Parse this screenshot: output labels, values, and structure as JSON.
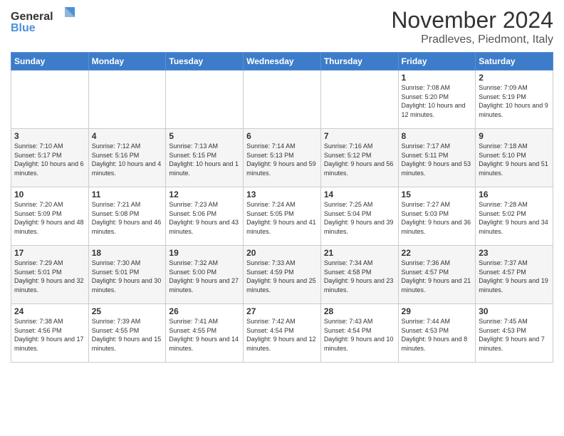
{
  "logo": {
    "line1": "General",
    "line2": "Blue"
  },
  "header": {
    "title": "November 2024",
    "location": "Pradleves, Piedmont, Italy"
  },
  "weekdays": [
    "Sunday",
    "Monday",
    "Tuesday",
    "Wednesday",
    "Thursday",
    "Friday",
    "Saturday"
  ],
  "weeks": [
    [
      {
        "day": "",
        "info": ""
      },
      {
        "day": "",
        "info": ""
      },
      {
        "day": "",
        "info": ""
      },
      {
        "day": "",
        "info": ""
      },
      {
        "day": "",
        "info": ""
      },
      {
        "day": "1",
        "info": "Sunrise: 7:08 AM\nSunset: 5:20 PM\nDaylight: 10 hours and 12 minutes."
      },
      {
        "day": "2",
        "info": "Sunrise: 7:09 AM\nSunset: 5:19 PM\nDaylight: 10 hours and 9 minutes."
      }
    ],
    [
      {
        "day": "3",
        "info": "Sunrise: 7:10 AM\nSunset: 5:17 PM\nDaylight: 10 hours and 6 minutes."
      },
      {
        "day": "4",
        "info": "Sunrise: 7:12 AM\nSunset: 5:16 PM\nDaylight: 10 hours and 4 minutes."
      },
      {
        "day": "5",
        "info": "Sunrise: 7:13 AM\nSunset: 5:15 PM\nDaylight: 10 hours and 1 minute."
      },
      {
        "day": "6",
        "info": "Sunrise: 7:14 AM\nSunset: 5:13 PM\nDaylight: 9 hours and 59 minutes."
      },
      {
        "day": "7",
        "info": "Sunrise: 7:16 AM\nSunset: 5:12 PM\nDaylight: 9 hours and 56 minutes."
      },
      {
        "day": "8",
        "info": "Sunrise: 7:17 AM\nSunset: 5:11 PM\nDaylight: 9 hours and 53 minutes."
      },
      {
        "day": "9",
        "info": "Sunrise: 7:18 AM\nSunset: 5:10 PM\nDaylight: 9 hours and 51 minutes."
      }
    ],
    [
      {
        "day": "10",
        "info": "Sunrise: 7:20 AM\nSunset: 5:09 PM\nDaylight: 9 hours and 48 minutes."
      },
      {
        "day": "11",
        "info": "Sunrise: 7:21 AM\nSunset: 5:08 PM\nDaylight: 9 hours and 46 minutes."
      },
      {
        "day": "12",
        "info": "Sunrise: 7:23 AM\nSunset: 5:06 PM\nDaylight: 9 hours and 43 minutes."
      },
      {
        "day": "13",
        "info": "Sunrise: 7:24 AM\nSunset: 5:05 PM\nDaylight: 9 hours and 41 minutes."
      },
      {
        "day": "14",
        "info": "Sunrise: 7:25 AM\nSunset: 5:04 PM\nDaylight: 9 hours and 39 minutes."
      },
      {
        "day": "15",
        "info": "Sunrise: 7:27 AM\nSunset: 5:03 PM\nDaylight: 9 hours and 36 minutes."
      },
      {
        "day": "16",
        "info": "Sunrise: 7:28 AM\nSunset: 5:02 PM\nDaylight: 9 hours and 34 minutes."
      }
    ],
    [
      {
        "day": "17",
        "info": "Sunrise: 7:29 AM\nSunset: 5:01 PM\nDaylight: 9 hours and 32 minutes."
      },
      {
        "day": "18",
        "info": "Sunrise: 7:30 AM\nSunset: 5:01 PM\nDaylight: 9 hours and 30 minutes."
      },
      {
        "day": "19",
        "info": "Sunrise: 7:32 AM\nSunset: 5:00 PM\nDaylight: 9 hours and 27 minutes."
      },
      {
        "day": "20",
        "info": "Sunrise: 7:33 AM\nSunset: 4:59 PM\nDaylight: 9 hours and 25 minutes."
      },
      {
        "day": "21",
        "info": "Sunrise: 7:34 AM\nSunset: 4:58 PM\nDaylight: 9 hours and 23 minutes."
      },
      {
        "day": "22",
        "info": "Sunrise: 7:36 AM\nSunset: 4:57 PM\nDaylight: 9 hours and 21 minutes."
      },
      {
        "day": "23",
        "info": "Sunrise: 7:37 AM\nSunset: 4:57 PM\nDaylight: 9 hours and 19 minutes."
      }
    ],
    [
      {
        "day": "24",
        "info": "Sunrise: 7:38 AM\nSunset: 4:56 PM\nDaylight: 9 hours and 17 minutes."
      },
      {
        "day": "25",
        "info": "Sunrise: 7:39 AM\nSunset: 4:55 PM\nDaylight: 9 hours and 15 minutes."
      },
      {
        "day": "26",
        "info": "Sunrise: 7:41 AM\nSunset: 4:55 PM\nDaylight: 9 hours and 14 minutes."
      },
      {
        "day": "27",
        "info": "Sunrise: 7:42 AM\nSunset: 4:54 PM\nDaylight: 9 hours and 12 minutes."
      },
      {
        "day": "28",
        "info": "Sunrise: 7:43 AM\nSunset: 4:54 PM\nDaylight: 9 hours and 10 minutes."
      },
      {
        "day": "29",
        "info": "Sunrise: 7:44 AM\nSunset: 4:53 PM\nDaylight: 9 hours and 8 minutes."
      },
      {
        "day": "30",
        "info": "Sunrise: 7:45 AM\nSunset: 4:53 PM\nDaylight: 9 hours and 7 minutes."
      }
    ]
  ]
}
